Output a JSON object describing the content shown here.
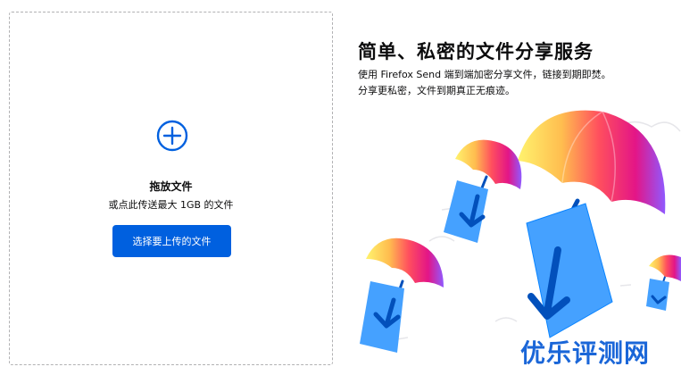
{
  "upload": {
    "drop_title": "拖放文件",
    "drop_subtitle": "或点此传送最大 1GB 的文件",
    "button_label": "选择要上传的文件"
  },
  "intro": {
    "headline": "简单、私密的文件分享服务",
    "description": "使用 Firefox Send 端到端加密分享文件，链接到期即焚。分享更私密，文件到期真正无痕迹。"
  },
  "watermark": "优乐评测网",
  "colors": {
    "accent": "#0060df",
    "umbrella_yellow": "#fff36e",
    "umbrella_orange": "#ff9400",
    "umbrella_pink": "#ff4f5e",
    "umbrella_purple": "#9059ff",
    "box_blue": "#45a1ff"
  }
}
